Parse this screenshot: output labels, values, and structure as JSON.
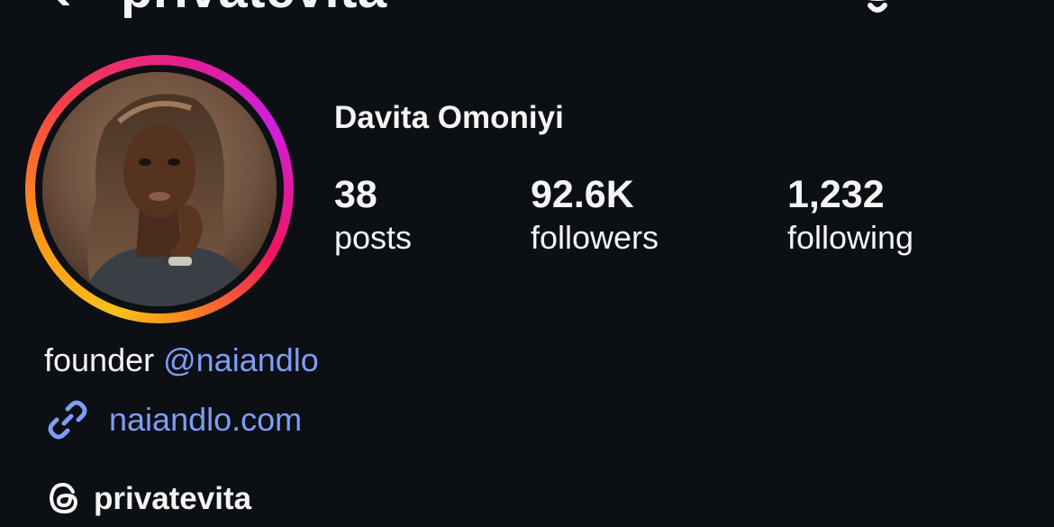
{
  "header": {
    "username": "privatevita",
    "back_icon": "chevron-left-icon",
    "notifications_icon": "bell-icon"
  },
  "profile": {
    "display_name": "Davita Omoniyi",
    "avatar": "profile-photo",
    "ring_colors": [
      "#f6c21b",
      "#fb8c1a",
      "#f5414a",
      "#e51e8d",
      "#d11ee0"
    ]
  },
  "stats": {
    "posts": {
      "value": "38",
      "label": "posts"
    },
    "followers": {
      "value": "92.6K",
      "label": "followers"
    },
    "following": {
      "value": "1,232",
      "label": "following"
    }
  },
  "bio": {
    "text": "founder ",
    "mention": "@naiandlo",
    "link_icon": "link-icon",
    "link": "naiandlo.com"
  },
  "threads": {
    "icon": "threads-icon",
    "handle": "privatevita"
  },
  "colors": {
    "background": "#0c0f14",
    "text": "#f5f5f5",
    "link": "#7f9df5"
  }
}
